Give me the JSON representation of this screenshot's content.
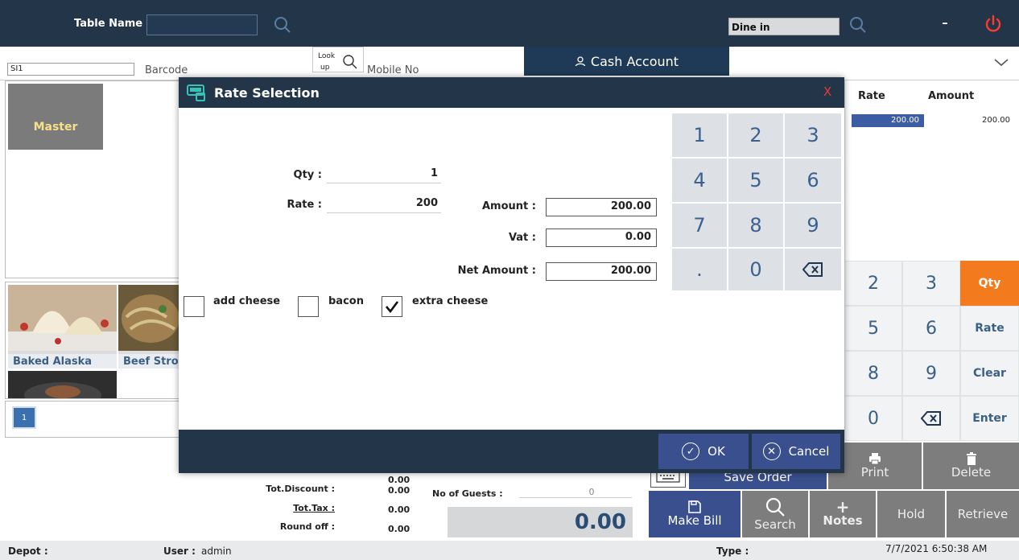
{
  "topbar": {
    "table_name_label": "Table Name :",
    "table_name_value": "",
    "dine_value": "Dine in",
    "minimize": "-",
    "power_icon": "power-icon",
    "search_icon": "search-icon"
  },
  "row2": {
    "code_value": "SI1",
    "barcode_label": "Barcode",
    "lookup_label_1": "Look",
    "lookup_label_2": "up",
    "mobile_label": "Mobile No",
    "cash_account_label": "Cash Account"
  },
  "left": {
    "master_label": "Master",
    "items": [
      {
        "name": "Baked Alaska"
      },
      {
        "name": "Beef Strog"
      }
    ],
    "page_number": "1"
  },
  "right_table": {
    "headers": [
      "Rate",
      "Amount"
    ],
    "rows": [
      {
        "rate": "200.00",
        "amount": "200.00"
      }
    ]
  },
  "right_keypad": {
    "keys": [
      "2",
      "3",
      "Qty",
      "5",
      "6",
      "Rate",
      "8",
      "9",
      "Clear",
      "0",
      "⌫",
      "Enter"
    ]
  },
  "actions": {
    "print": "Print",
    "delete": "Delete",
    "save_order": "Save Order",
    "make_bill": "Make Bill",
    "search": "Search",
    "notes": "Notes",
    "hold": "Hold",
    "retrieve": "Retrieve"
  },
  "totals": {
    "top_value": "0.00",
    "discount_label": "Tot.Discount :",
    "discount_value": "0.00",
    "tax_label": "Tot.Tax :",
    "tax_value": "0.00",
    "round_label": "Round off :",
    "round_value": "0.00",
    "guests_label": "No of Guests :",
    "guests_value": "0",
    "grand_total": "0.00"
  },
  "status": {
    "depot_label": "Depot :",
    "user_label": "User :",
    "user_value": "admin",
    "type_label": "Type :",
    "datetime": "7/7/2021 6:50:38 AM"
  },
  "modal": {
    "title": "Rate Selection",
    "close": "X",
    "qty_label": "Qty :",
    "qty_value": "1",
    "rate_label": "Rate :",
    "rate_value": "200",
    "amount_label": "Amount :",
    "amount_value": "200.00",
    "vat_label": "Vat :",
    "vat_value": "0.00",
    "net_label": "Net Amount :",
    "net_value": "200.00",
    "keys": [
      "1",
      "2",
      "3",
      "4",
      "5",
      "6",
      "7",
      "8",
      "9",
      ".",
      "0",
      "⌫"
    ],
    "options": [
      {
        "label": "add cheese",
        "checked": false
      },
      {
        "label": "bacon",
        "checked": false
      },
      {
        "label": "extra cheese",
        "checked": true
      }
    ],
    "ok_label": "OK",
    "cancel_label": "Cancel"
  },
  "colors": {
    "navy": "#233548",
    "accent_orange": "#f37b1d",
    "button_blue": "#3a4f8d",
    "close_red": "#e53935"
  }
}
